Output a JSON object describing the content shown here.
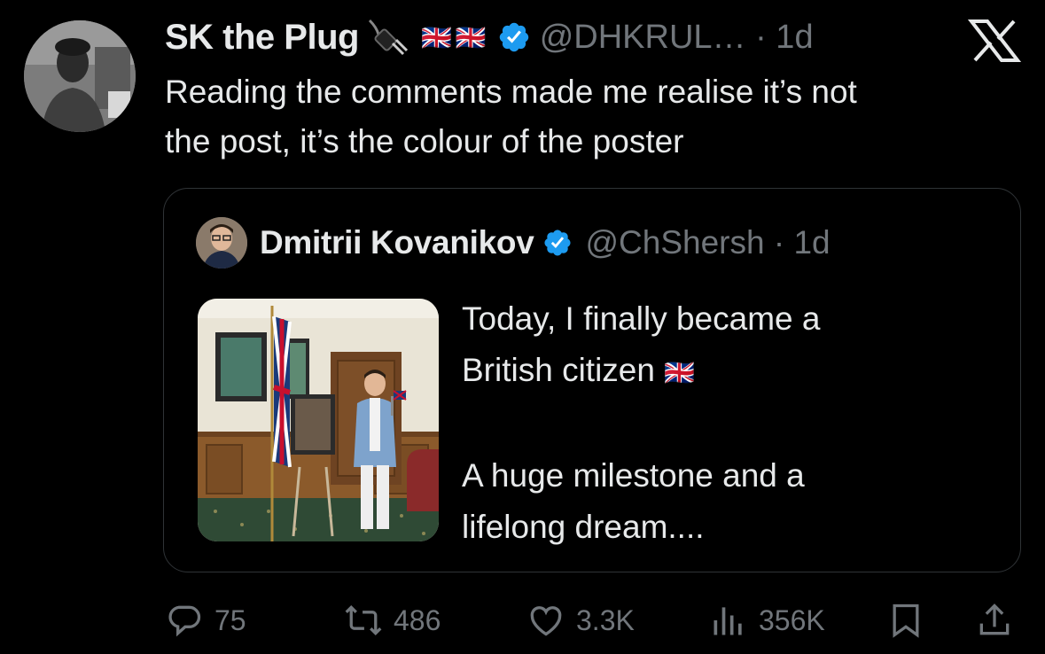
{
  "tweet": {
    "display_name": "SK the Plug",
    "name_emoji_flags": [
      "🇬🇧",
      "🇬🇧"
    ],
    "handle": "@DHKRUL…",
    "time": "· 1d",
    "text_line1": "Reading the comments made me realise it’s not",
    "text_line2": "the post, it’s the colour of the poster"
  },
  "quoted": {
    "display_name": "Dmitrii Kovanikov",
    "handle": "@ChShersh",
    "time": "· 1d",
    "line1": "Today, I finally became a",
    "line2": "British citizen",
    "flag": "🇬🇧",
    "line3": "A huge milestone and a",
    "line4": "lifelong dream...."
  },
  "actions": {
    "replies": "75",
    "reposts": "486",
    "likes": "3.3K",
    "views": "356K"
  },
  "icons": {
    "verified": "verified-badge-icon",
    "logo": "x-logo-icon",
    "reply": "reply-icon",
    "repost": "repost-icon",
    "like": "heart-icon",
    "views": "views-icon",
    "bookmark": "bookmark-icon",
    "share": "share-icon"
  },
  "colors": {
    "background": "#000000",
    "text": "#e7e9ea",
    "muted": "#71767b",
    "verified_blue": "#1d9bf0",
    "border": "#2f3336"
  }
}
